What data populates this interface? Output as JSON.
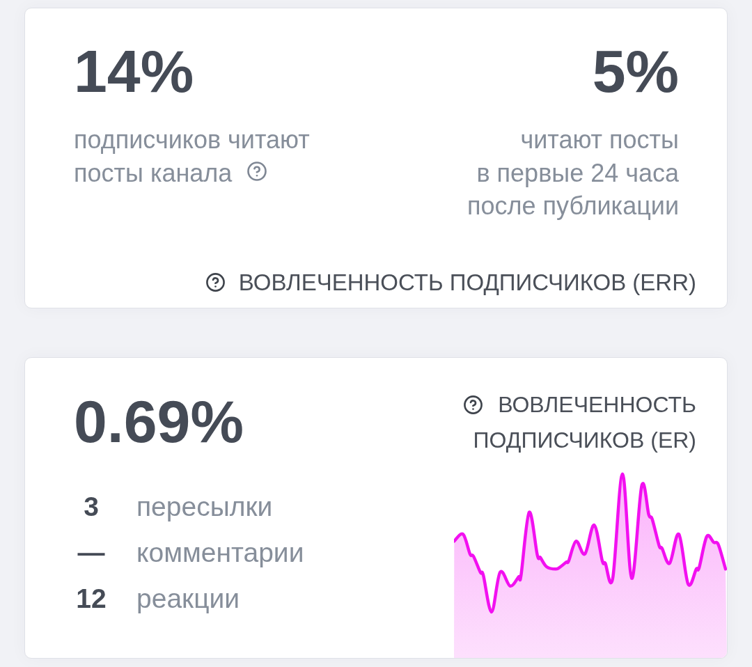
{
  "err_card": {
    "metrics": [
      {
        "value": "14%",
        "caption_lines": [
          "подписчиков читают",
          "посты канала"
        ],
        "help": true
      },
      {
        "value": "5%",
        "caption_lines": [
          "читают посты",
          "в первые 24 часа",
          "после публикации"
        ],
        "help": false
      }
    ],
    "title": "ВОВЛЕЧЕННОСТЬ ПОДПИСЧИКОВ (ERR)"
  },
  "er_card": {
    "value": "0.69%",
    "stats": [
      {
        "value": "3",
        "label": "пересылки"
      },
      {
        "value": "—",
        "label": "комментарии"
      },
      {
        "value": "12",
        "label": "реакции"
      }
    ],
    "title_lines": [
      "ВОВЛЕЧЕННОСТЬ",
      "ПОДПИСЧИКОВ (ER)"
    ]
  }
}
